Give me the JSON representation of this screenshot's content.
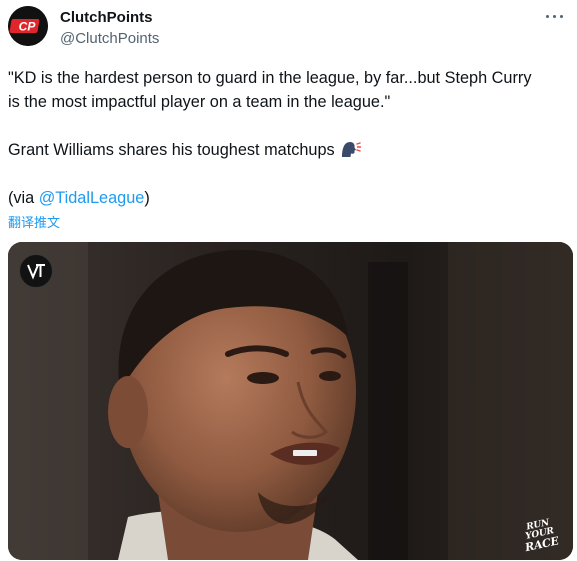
{
  "author": {
    "display_name": "ClutchPoints",
    "handle": "@ClutchPoints",
    "avatar_text": "CP"
  },
  "tweet": {
    "line1": "\"KD is the hardest person to guard in the league, by far...but Steph Curry",
    "line2": "is the most impactful player on a team in the league.\"",
    "line3": "Grant Williams shares his toughest matchups",
    "line4_prefix": "(via ",
    "line4_mention": "@TidalLeague",
    "line4_suffix": ")",
    "translate_label": "翻译推文"
  },
  "media": {
    "watermark_bottom": [
      "RUN",
      "YOUR",
      "RACE"
    ]
  },
  "icons": {
    "more": "more-horizontal-icon",
    "emoji": "speaking-head-icon",
    "watermark": "tidal-league-logo-icon"
  },
  "colors": {
    "link": "#1d9bf0",
    "text": "#0f1419",
    "secondary": "#536471",
    "brand_red": "#e0262b"
  }
}
